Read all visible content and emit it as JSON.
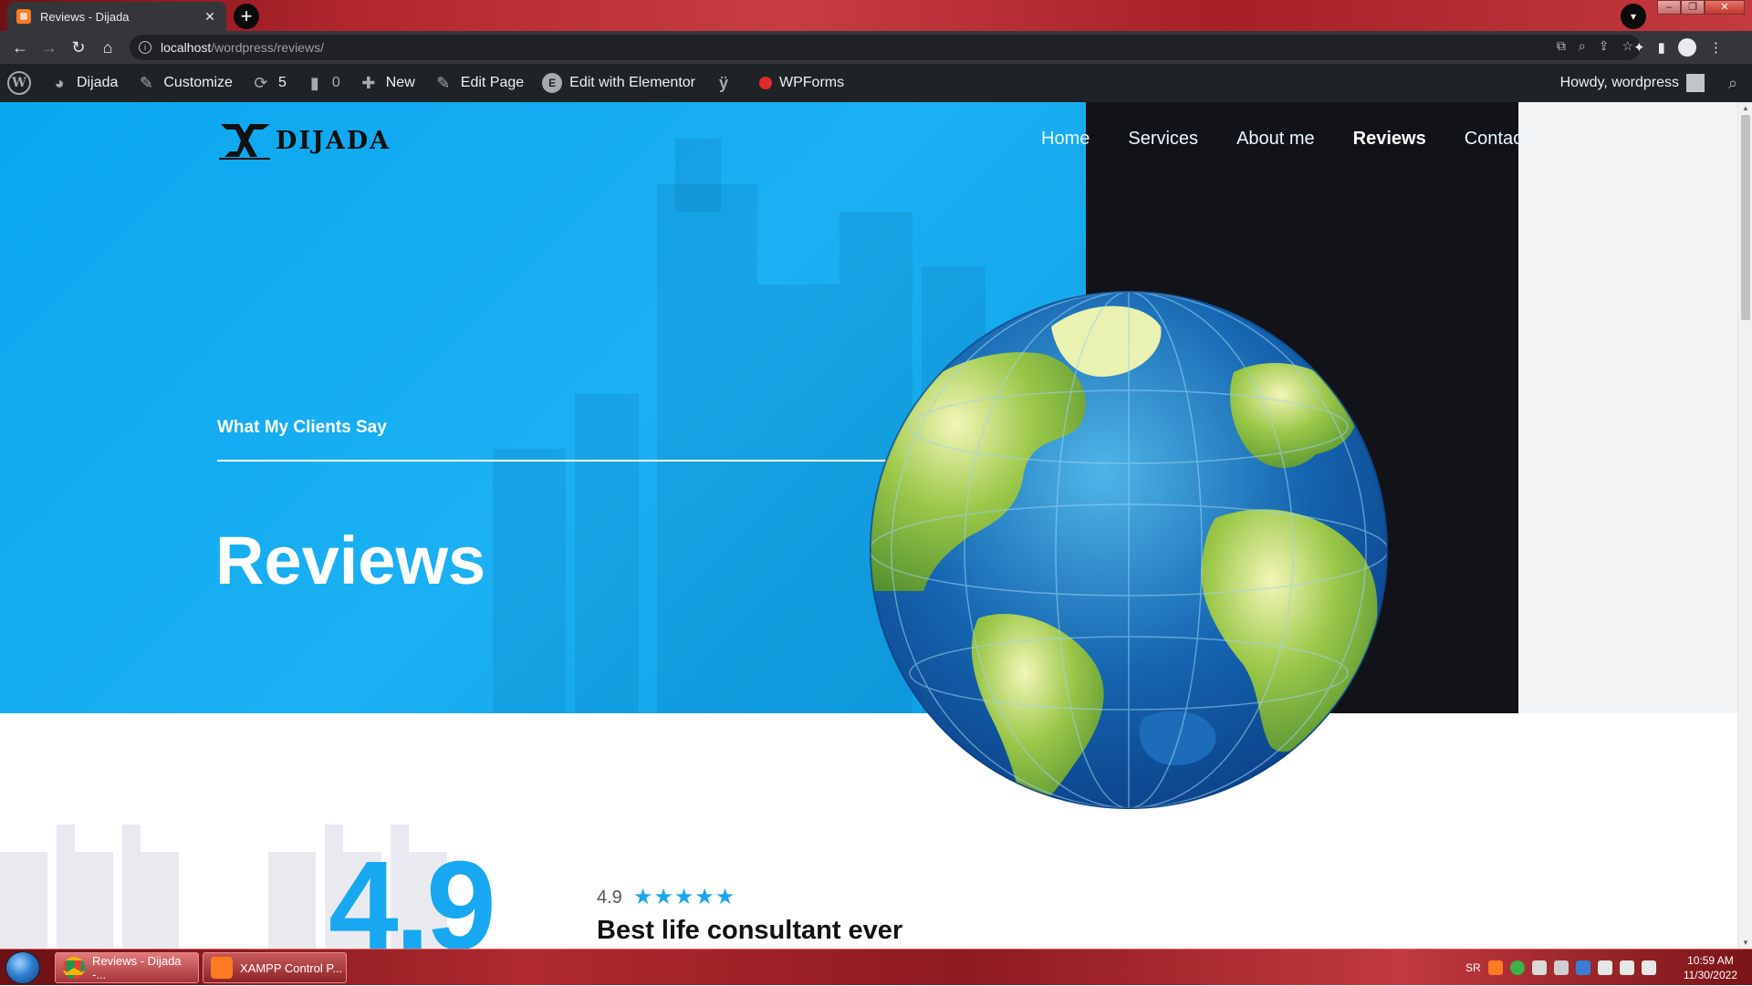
{
  "browser": {
    "tab_title": "Reviews - Dijada",
    "tab_favicon": "XAMPP",
    "new_tab_icon": "+",
    "url_host": "localhost",
    "url_path": "/wordpress/reviews/"
  },
  "adminbar": {
    "site_name": "Dijada",
    "customize": "Customize",
    "updates_count": "5",
    "comments_count": "0",
    "new": "New",
    "edit_page": "Edit Page",
    "edit_with_elementor": "Edit with Elementor",
    "wpforms": "WPForms",
    "howdy": "Howdy, wordpress"
  },
  "site": {
    "logo_text": "DIJADA",
    "nav": [
      {
        "label": "Home"
      },
      {
        "label": "Services"
      },
      {
        "label": "About me"
      },
      {
        "label": "Reviews",
        "active": true
      },
      {
        "label": "Contact"
      }
    ]
  },
  "hero": {
    "subtitle": "What My Clients Say",
    "title": "Reviews"
  },
  "review": {
    "big_rating": "4.9",
    "score": "4.9",
    "stars": 5,
    "heading": "Best life consultant ever"
  },
  "taskbar": {
    "items": [
      {
        "label": "Reviews - Dijada -..."
      },
      {
        "label": "XAMPP Control P..."
      }
    ],
    "language": "SR",
    "time": "10:59 AM",
    "date": "11/30/2022"
  },
  "colors": {
    "hero_blue": "#0aa7ef",
    "hero_dark": "#111318",
    "accent": "#17a8f1",
    "admin_bar": "#1d2327"
  }
}
